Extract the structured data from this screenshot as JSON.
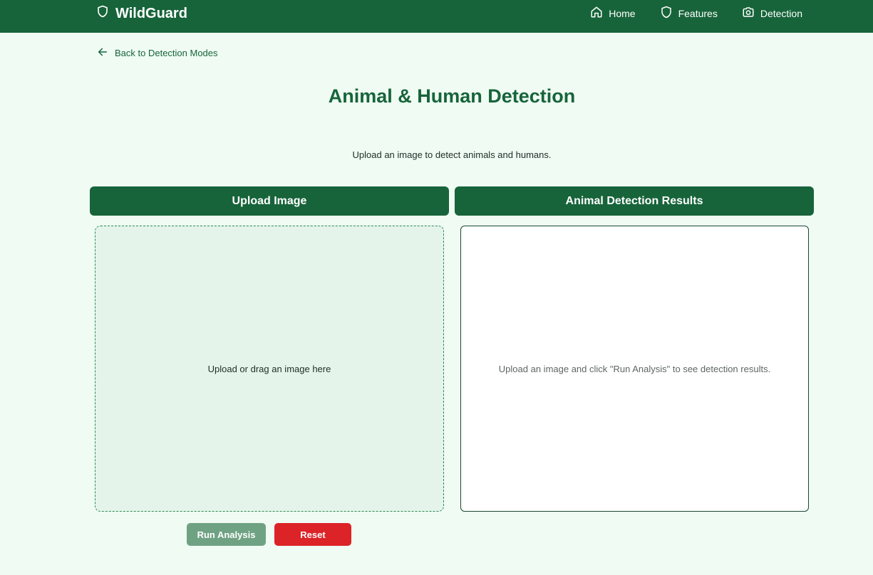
{
  "nav": {
    "brand": "WildGuard",
    "links": [
      {
        "label": "Home",
        "icon": "home-icon"
      },
      {
        "label": "Features",
        "icon": "shield-icon"
      },
      {
        "label": "Detection",
        "icon": "camera-icon"
      }
    ]
  },
  "back_link": {
    "label": "Back to Detection Modes",
    "icon": "arrow-left-icon"
  },
  "page": {
    "title": "Animal & Human Detection",
    "subtitle": "Upload an image to detect animals and humans."
  },
  "upload_panel": {
    "header": "Upload Image",
    "dropzone_text": "Upload or drag an image here"
  },
  "results_panel": {
    "header": "Animal Detection Results",
    "placeholder": "Upload an image and click \"Run Analysis\" to see detection results."
  },
  "buttons": {
    "run_analysis": "Run Analysis",
    "reset": "Reset"
  },
  "colors": {
    "primary": "#17643a",
    "background": "#effbf3",
    "run_disabled": "#6fa283",
    "reset": "#dc2327"
  }
}
